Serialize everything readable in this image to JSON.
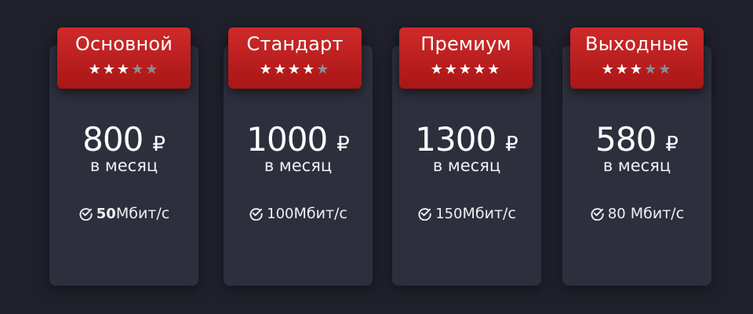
{
  "plans": [
    {
      "name": "Основной",
      "rating": 3,
      "rating_max": 5,
      "price": "800",
      "currency": "₽",
      "period": "в месяц",
      "speed_value": "50",
      "speed_unit": "Мбит/с"
    },
    {
      "name": "Стандарт",
      "rating": 4,
      "rating_max": 5,
      "price": "1000",
      "currency": "₽",
      "period": "в месяц",
      "speed_value": "100",
      "speed_unit": "Мбит/с"
    },
    {
      "name": "Премиум",
      "rating": 5,
      "rating_max": 5,
      "price": "1300",
      "currency": "₽",
      "period": "в месяц",
      "speed_value": "150",
      "speed_unit": "Мбит/с"
    },
    {
      "name": "Выходные",
      "rating": 3,
      "rating_max": 5,
      "price": "580",
      "currency": "₽",
      "period": "в месяц",
      "speed_value": "80",
      "speed_unit": "Мбит/с"
    }
  ],
  "icons": {
    "star": "star-icon",
    "check": "check-circle-icon"
  },
  "colors": {
    "background": "#1f202a",
    "card": "#2e2f3d",
    "header": "#c01f1f",
    "star_on": "#ffffff",
    "star_off": "#8e8d94"
  }
}
